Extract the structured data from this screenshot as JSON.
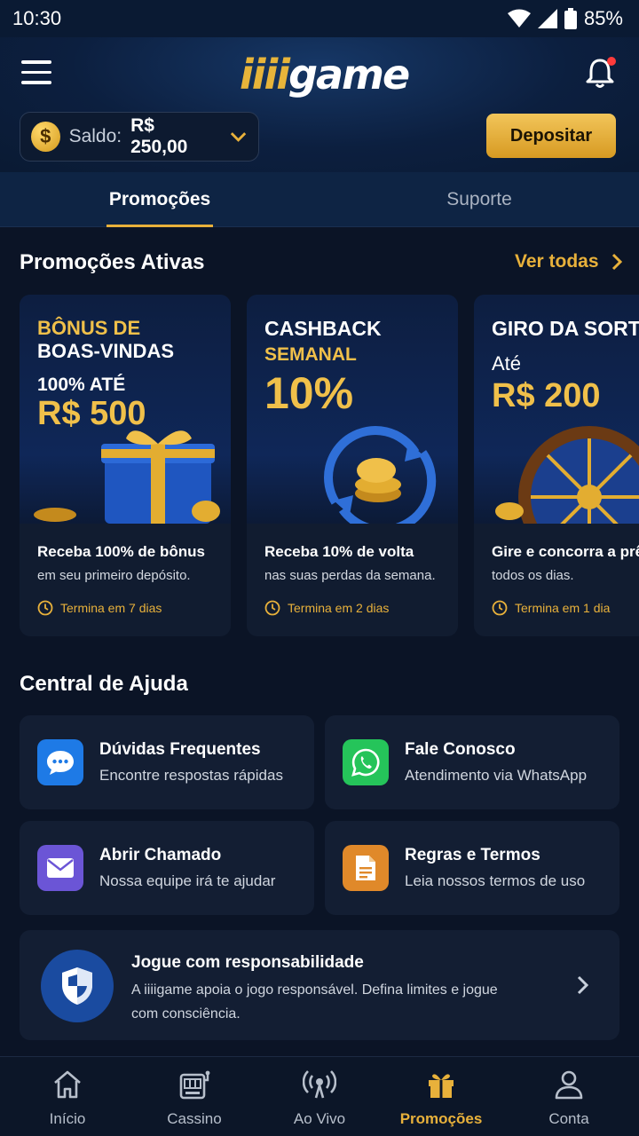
{
  "status_bar": {
    "time": "10:30",
    "battery": "85%"
  },
  "header": {
    "logo_part1": "iiii",
    "logo_part2": "game",
    "balance_label": "Saldo:",
    "balance_value": "R$ 250,00",
    "deposit_label": "Depositar"
  },
  "tabs": [
    {
      "label": "Promoções",
      "active": true
    },
    {
      "label": "Suporte",
      "active": false
    }
  ],
  "promotions": {
    "title": "Promoções Ativas",
    "see_all": "Ver todas",
    "cards": [
      {
        "art_lines": [
          "BÔNUS DE",
          "BOAS-VINDAS",
          "100% ATÉ",
          "R$ 500"
        ],
        "title": "Receba 100% de bônus",
        "subtitle": "em seu primeiro depósito.",
        "ends": "Termina em 7 dias"
      },
      {
        "art_lines": [
          "CASHBACK",
          "SEMANAL",
          "10%"
        ],
        "title": "Receba 10% de volta",
        "subtitle": "nas suas perdas da semana.",
        "ends": "Termina em 2 dias"
      },
      {
        "art_lines": [
          "GIRO DA SORTE",
          "Até",
          "R$ 200"
        ],
        "title": "Gire e concorra a prêmios",
        "subtitle": "todos os dias.",
        "ends": "Termina em 1 dia"
      }
    ]
  },
  "help_center": {
    "title": "Central de Ajuda",
    "items": [
      {
        "title": "Dúvidas Frequentes",
        "subtitle": "Encontre respostas rápidas",
        "icon": "chat-icon",
        "color": "#1e7ae6"
      },
      {
        "title": "Fale Conosco",
        "subtitle": "Atendimento via WhatsApp",
        "icon": "whatsapp-icon",
        "color": "#25c45a"
      },
      {
        "title": "Abrir Chamado",
        "subtitle": "Nossa equipe irá te ajudar",
        "icon": "mail-icon",
        "color": "#6b55d6"
      },
      {
        "title": "Regras e Termos",
        "subtitle": "Leia nossos termos de uso",
        "icon": "document-icon",
        "color": "#e0892a"
      }
    ]
  },
  "responsible": {
    "title": "Jogue com responsabilidade",
    "description": "A iiiigame apoia o jogo responsável. Defina limites e jogue com consciência."
  },
  "bottom_nav": [
    {
      "label": "Início",
      "icon": "home-icon",
      "active": false
    },
    {
      "label": "Cassino",
      "icon": "slot-machine-icon",
      "active": false
    },
    {
      "label": "Ao Vivo",
      "icon": "live-broadcast-icon",
      "active": false
    },
    {
      "label": "Promoções",
      "icon": "gift-icon",
      "active": true
    },
    {
      "label": "Conta",
      "icon": "user-icon",
      "active": false
    }
  ],
  "colors": {
    "accent": "#e8b13b",
    "background": "#0b1426",
    "card": "#131e33"
  }
}
